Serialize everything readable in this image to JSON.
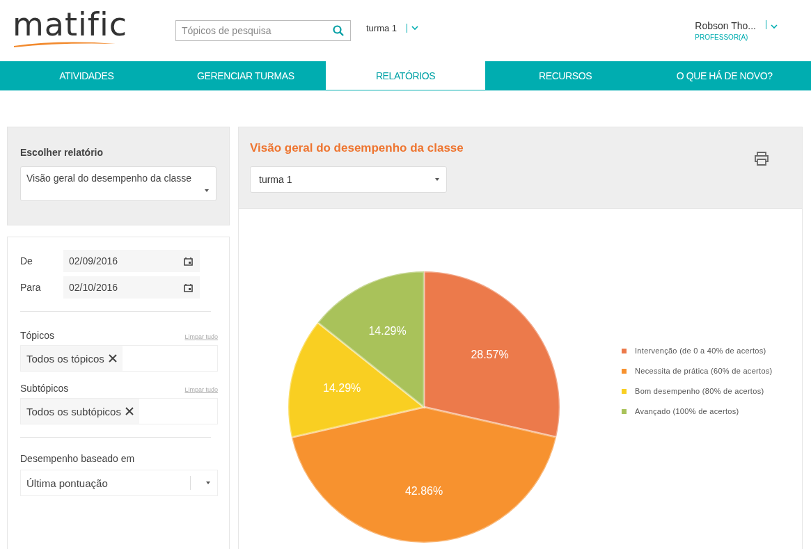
{
  "header": {
    "logo": "matific",
    "search": {
      "placeholder": "Tópicos de pesquisa"
    },
    "class_selector": "turma 1",
    "user": {
      "name": "Robson Tho...",
      "role": "PROFESSOR(A)"
    }
  },
  "nav": [
    {
      "label": "ATIVIDADES",
      "selected": false
    },
    {
      "label": "GERENCIAR TURMAS",
      "selected": false
    },
    {
      "label": "RELATÓRIOS",
      "selected": true
    },
    {
      "label": "RECURSOS",
      "selected": false
    },
    {
      "label": "O QUE HÁ DE NOVO?",
      "selected": false
    }
  ],
  "sidebar": {
    "report_label": "Escolher relatório",
    "report_value": "Visão geral do desempenho da classe",
    "dates": [
      {
        "label": "De",
        "value": "02/09/2016"
      },
      {
        "label": "Para",
        "value": "02/10/2016"
      }
    ],
    "filters": [
      {
        "label": "Tópicos",
        "clear": "Limpar tudo",
        "tag": "Todos os tópicos"
      },
      {
        "label": "Subtópicos",
        "clear": "Limpar tudo",
        "tag": "Todos os subtópicos"
      }
    ],
    "performance_label": "Desempenho baseado em",
    "performance_value": "Última pontuação"
  },
  "report": {
    "title": "Visão geral do desempenho da classe",
    "class_value": "turma 1",
    "chart_data": {
      "type": "pie",
      "categories": [
        "Intervenção (de 0 a 40% de acertos)",
        "Necessita de prática (60% de acertos)",
        "Bom desempenho (80% de acertos)",
        "Avançado (100% de acertos)"
      ],
      "values": [
        28.57,
        42.86,
        14.29,
        14.29
      ],
      "colors": [
        "#ec7a4b",
        "#f7922f",
        "#f9cf22",
        "#a9c25a"
      ],
      "value_labels": [
        "28.57%",
        "42.86%",
        "14.29%",
        "14.29%"
      ]
    }
  }
}
